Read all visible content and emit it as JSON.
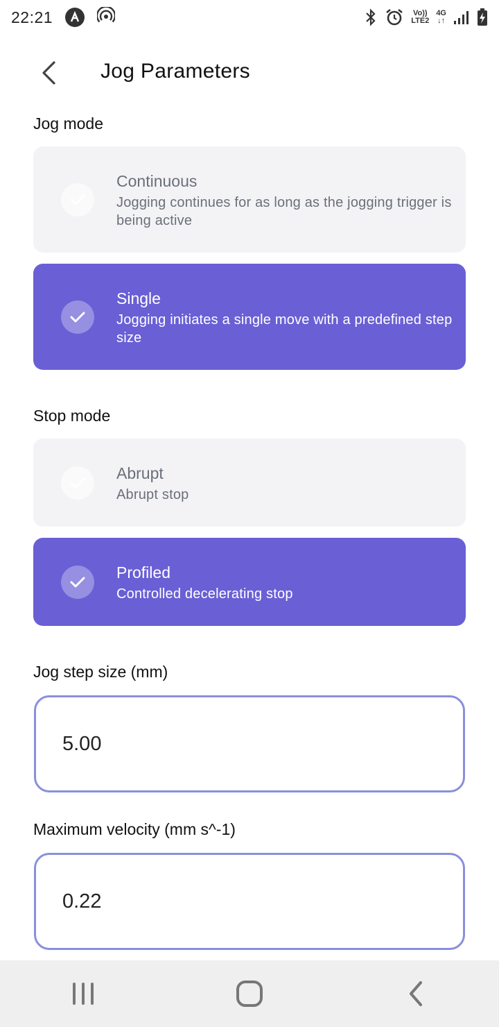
{
  "status_bar": {
    "time": "22:21",
    "network_top": "Vo))",
    "network_bottom": "LTE2",
    "data_label": "4G"
  },
  "header": {
    "title": "Jog Parameters"
  },
  "jog_mode": {
    "label": "Jog mode",
    "options": [
      {
        "title": "Continuous",
        "description": "Jogging continues for as long as the jogging trigger is being active",
        "selected": false
      },
      {
        "title": "Single",
        "description": "Jogging initiates a single move with a predefined step size",
        "selected": true
      }
    ]
  },
  "stop_mode": {
    "label": "Stop mode",
    "options": [
      {
        "title": "Abrupt",
        "description": "Abrupt stop",
        "selected": false
      },
      {
        "title": "Profiled",
        "description": "Controlled decelerating stop",
        "selected": true
      }
    ]
  },
  "jog_step_size": {
    "label": "Jog step size (mm)",
    "value": "5.00"
  },
  "max_velocity": {
    "label": "Maximum velocity (mm s^-1)",
    "value": "0.22"
  },
  "colors": {
    "accent": "#6a5fd5",
    "input_border": "#8a8fdc",
    "card_unselected": "#f3f3f5"
  },
  "icons": {
    "back": "chevron-left-icon",
    "check": "check-icon",
    "nav_recents": "recents-icon",
    "nav_home": "home-icon",
    "nav_back": "nav-back-icon"
  }
}
